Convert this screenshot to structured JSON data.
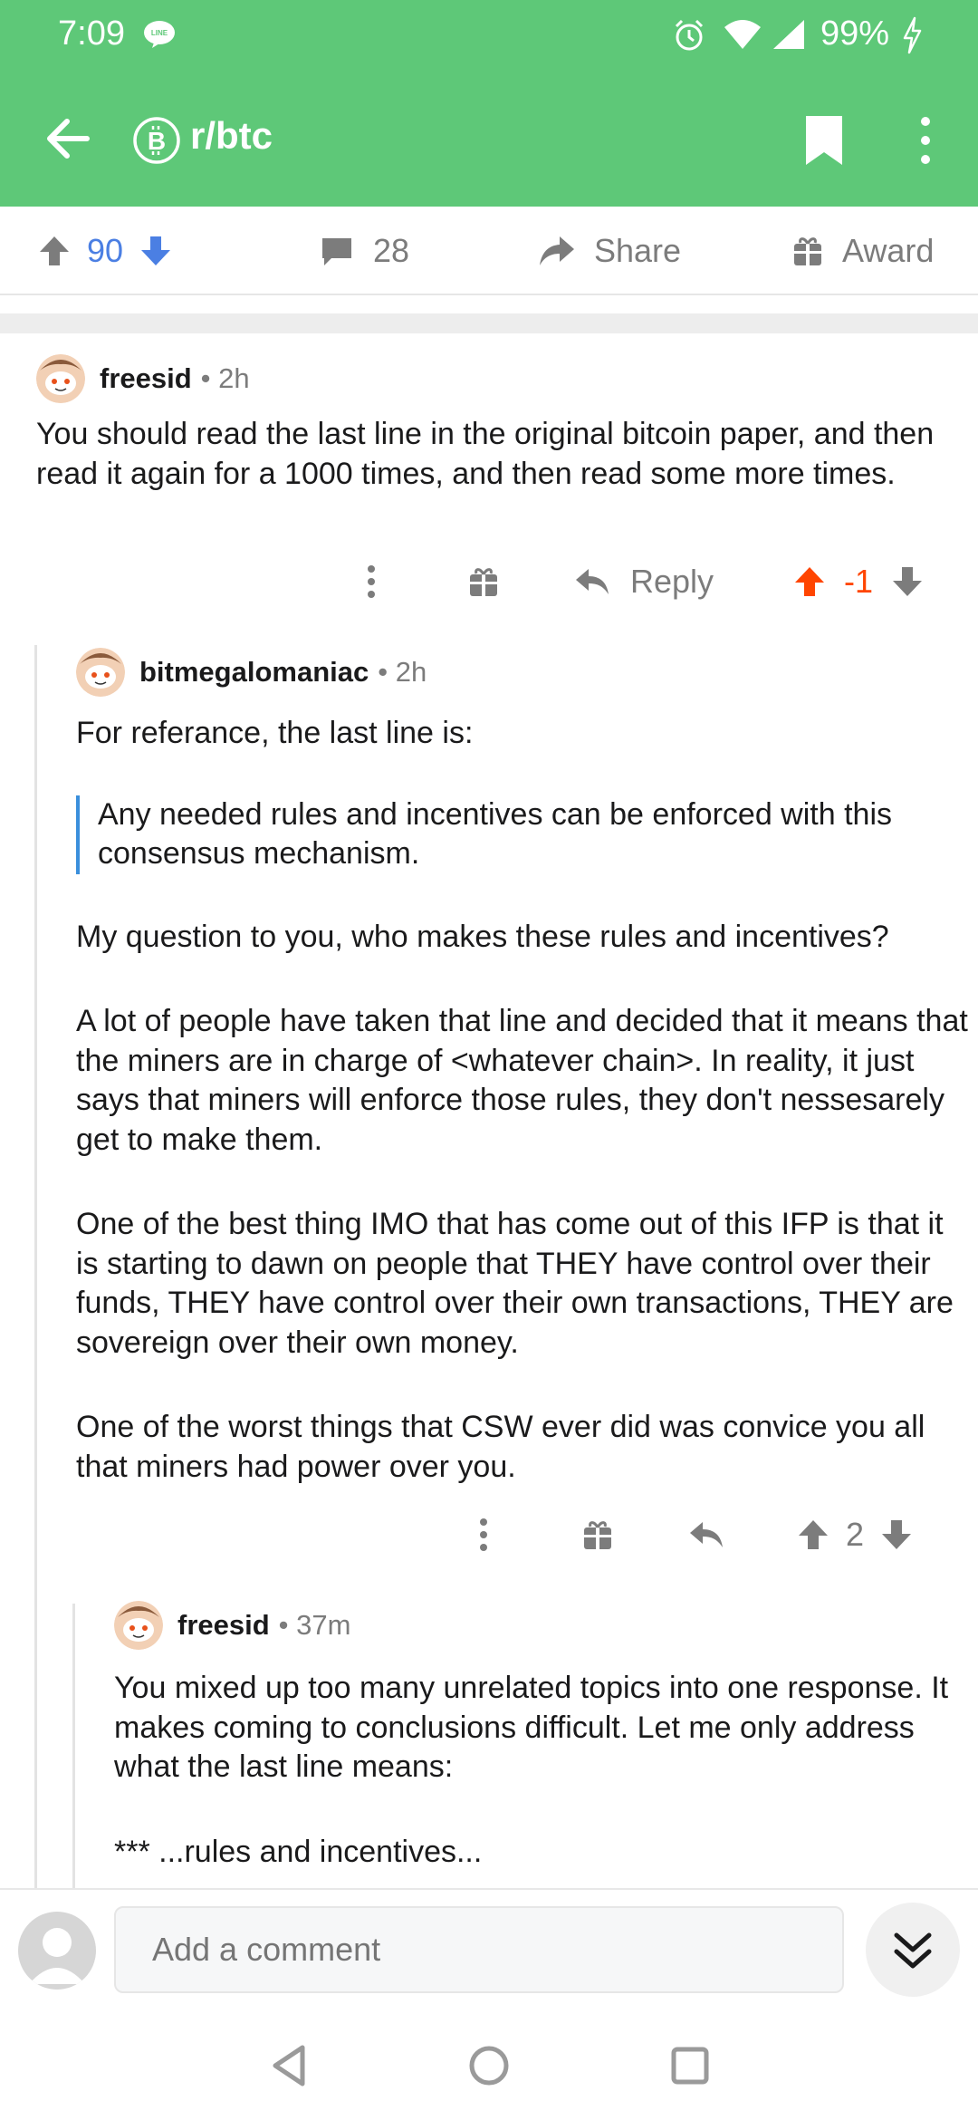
{
  "status_bar": {
    "time": "7:09",
    "battery": "99%"
  },
  "app_bar": {
    "subreddit": "r/btc"
  },
  "post_bar": {
    "score": "90",
    "comments": "28",
    "share_label": "Share",
    "award_label": "Award"
  },
  "comments": [
    {
      "author": "freesid",
      "time": "2h",
      "body": [
        "You should read the last line in the original bitcoin paper, and then read it again for a 1000 times, and then read some more times."
      ],
      "reply_label": "Reply",
      "score": "-1"
    },
    {
      "author": "bitmegalomaniac",
      "time": "2h",
      "intro": "For referance, the last line is:",
      "quote": "Any needed rules and incentives can be enforced with this consensus mechanism.",
      "paragraphs": [
        "My question to you, who makes these rules and incentives?",
        "A lot of people have taken that line and decided that it means that the miners are in charge of <whatever chain>. In reality, it just says that miners will enforce those rules, they don't nessesarely get to make them.",
        "One of the best thing IMO that has come out of this IFP is that it is starting to dawn on people that THEY have control over their funds, THEY have control over their own transactions, THEY are sovereign over their own money.",
        "One of the worst things that CSW ever did was convice you all that miners had power over you."
      ],
      "score": "2"
    },
    {
      "author": "freesid",
      "time": "37m",
      "paragraphs": [
        "You mixed up too many unrelated topics into one response.  It makes coming to conclusions difficult. Let me only address what the last line means:",
        "*** ...rules and incentives..."
      ]
    }
  ],
  "comment_bar": {
    "placeholder": "Add a comment"
  },
  "colors": {
    "header": "#5ec878",
    "upvote": "#ff4500",
    "link_blue": "#4b7fe3",
    "quote_bar": "#3a8fdc"
  }
}
